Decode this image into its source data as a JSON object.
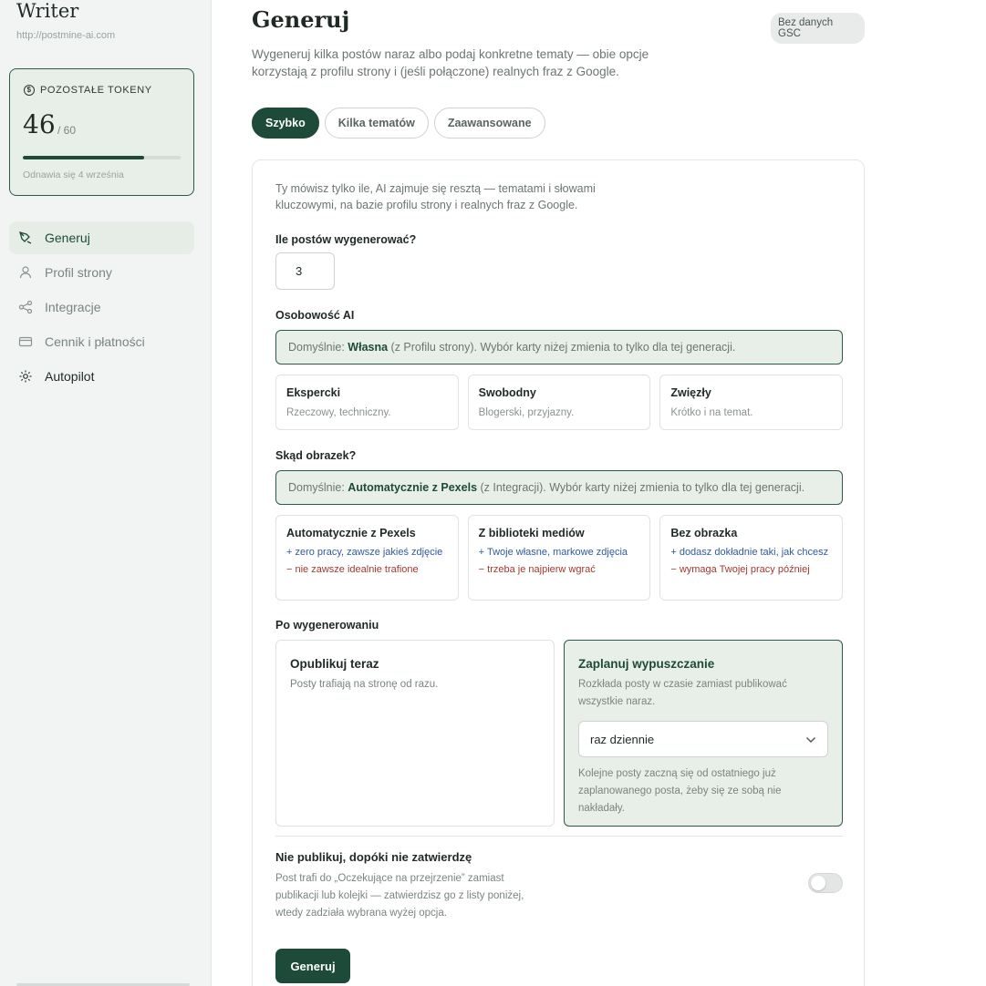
{
  "app": {
    "title": "Writer",
    "site_url": "http://postmine-ai.com"
  },
  "tokens": {
    "label": "POZOSTAŁE TOKENY",
    "value": "46",
    "max": "/ 60",
    "fraction": 0.77,
    "renew": "Odnawia się 4 września"
  },
  "nav": [
    {
      "label": "Generuj",
      "icon": "pen-icon",
      "active": true
    },
    {
      "label": "Profil strony",
      "icon": "user-icon"
    },
    {
      "label": "Integracje",
      "icon": "share-icon"
    },
    {
      "label": "Cennik i płatności",
      "icon": "card-icon"
    },
    {
      "label": "Autopilot",
      "icon": "gear-icon"
    }
  ],
  "header": {
    "title": "Generuj",
    "badge": "Bez danych GSC",
    "description": "Wygeneruj kilka postów naraz albo podaj konkretne tematy — obie opcje korzystają z profilu strony i (jeśli połączone) realnych fraz z Google."
  },
  "tabs": [
    "Szybko",
    "Kilka tematów",
    "Zaawansowane"
  ],
  "form": {
    "intro": "Ty mówisz tylko ile, AI zajmuje się resztą — tematami i słowami kluczowymi, na bazie profilu strony i realnych fraz z Google.",
    "count_label": "Ile postów wygenerować?",
    "count_value": "3",
    "personality": {
      "label": "Osobowość AI",
      "default_prefix": "Domyślnie: ",
      "default_value": "Własna",
      "default_suffix": " (z Profilu strony). Wybór karty niżej zmienia to tylko dla tej generacji.",
      "options": [
        {
          "title": "Ekspercki",
          "sub": "Rzeczowy, techniczny."
        },
        {
          "title": "Swobodny",
          "sub": "Blogerski, przyjazny."
        },
        {
          "title": "Zwięzły",
          "sub": "Krótko i na temat."
        }
      ]
    },
    "image": {
      "label": "Skąd obrazek?",
      "default_prefix": "Domyślnie: ",
      "default_value": "Automatycznie z Pexels",
      "default_suffix": " (z Integracji). Wybór karty niżej zmienia to tylko dla tej generacji.",
      "options": [
        {
          "title": "Automatycznie z Pexels",
          "pro": "+ zero pracy, zawsze jakieś zdjęcie",
          "con": "− nie zawsze idealnie trafione"
        },
        {
          "title": "Z biblioteki mediów",
          "pro": "+ Twoje własne, markowe zdjęcia",
          "con": "− trzeba je najpierw wgrać"
        },
        {
          "title": "Bez obrazka",
          "pro": "+ dodasz dokładnie taki, jak chcesz",
          "con": "− wymaga Twojej pracy później"
        }
      ]
    },
    "after": {
      "label": "Po wygenerowaniu",
      "publish_now": {
        "title": "Opublikuj teraz",
        "desc": "Posty trafiają na stronę od razu."
      },
      "schedule": {
        "title": "Zaplanuj wypuszczanie",
        "desc": "Rozkłada posty w czasie zamiast publikować wszystkie naraz.",
        "select_value": "raz dziennie",
        "note": "Kolejne posty zaczną się od ostatniego już zaplanowanego posta, żeby się ze sobą nie nakładały."
      }
    },
    "approve": {
      "title": "Nie publikuj, dopóki nie zatwierdzę",
      "desc": "Post trafi do „Oczekujące na przejrzenie” zamiast publikacji lub kolejki — zatwierdzisz go z listy poniżej, wtedy zadziała wybrana wyżej opcja.",
      "enabled": false
    },
    "submit_label": "Generuj"
  },
  "colors": {
    "accent": "#1e4a3a",
    "accent_bg": "#e7efe8",
    "pro": "#2f5aa0",
    "con": "#a03a30"
  }
}
